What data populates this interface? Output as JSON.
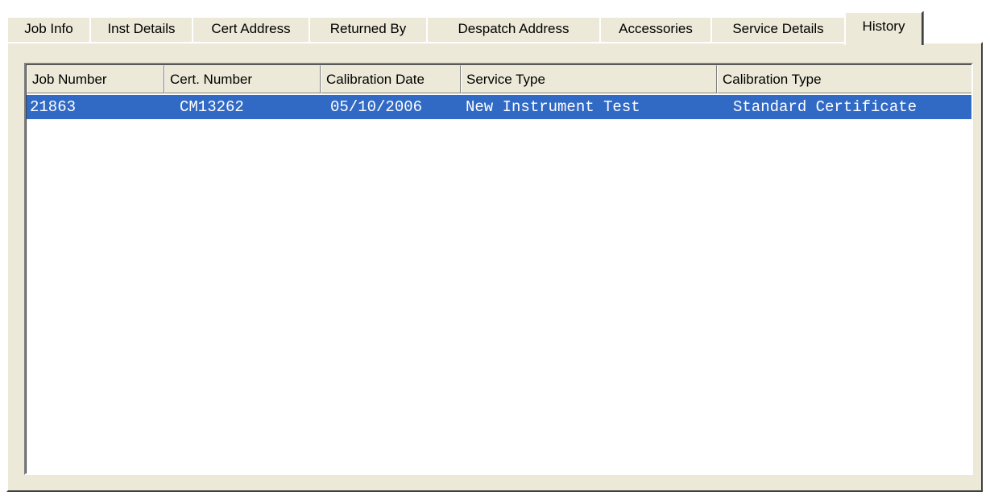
{
  "tabs": [
    {
      "label": "Job Info",
      "active": false
    },
    {
      "label": "Inst Details",
      "active": false
    },
    {
      "label": "Cert Address",
      "active": false
    },
    {
      "label": "Returned By",
      "active": false
    },
    {
      "label": "Despatch Address",
      "active": false
    },
    {
      "label": "Accessories",
      "active": false
    },
    {
      "label": "Service Details",
      "active": false
    },
    {
      "label": "History",
      "active": true
    }
  ],
  "history": {
    "columns": [
      "Job Number",
      "Cert. Number",
      "Calibration Date",
      "Service Type",
      "Calibration Type"
    ],
    "rows": [
      {
        "job_number": "21863",
        "cert_number": "CM13262",
        "calibration_date": "05/10/2006",
        "service_type": "New Instrument Test",
        "calibration_type": "Standard Certificate",
        "selected": true
      }
    ]
  },
  "colors": {
    "face": "#ece9d8",
    "selection": "#316ac5",
    "selection_text": "#ffffff"
  }
}
